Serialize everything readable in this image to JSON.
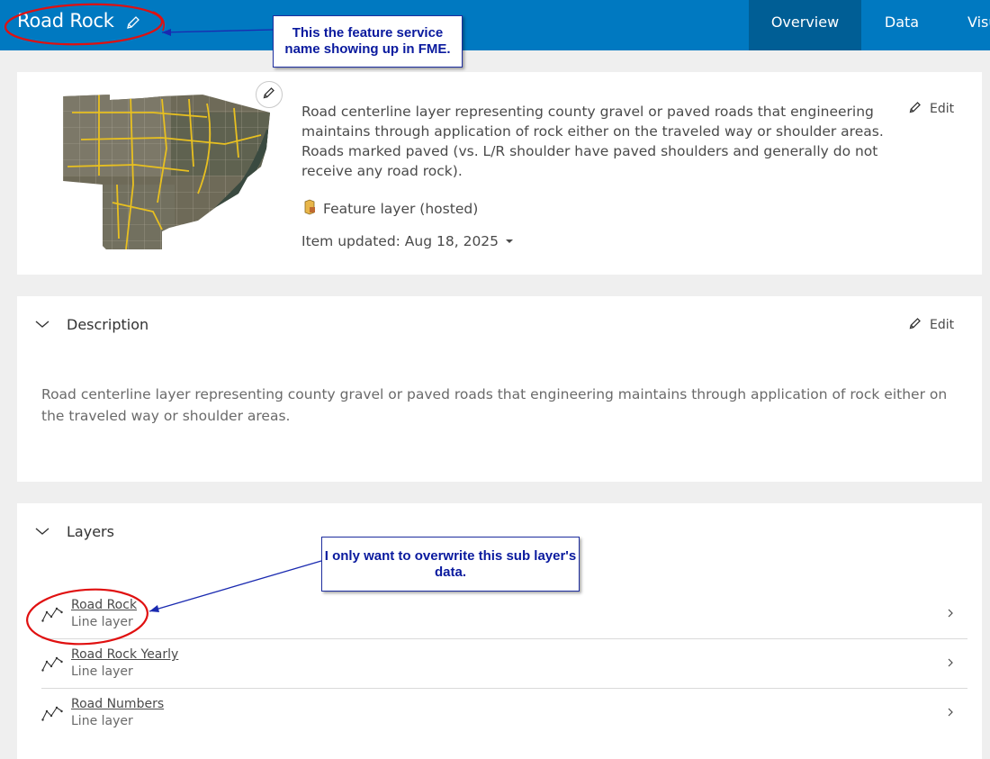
{
  "header": {
    "title": "Road Rock",
    "tabs": [
      {
        "label": "Overview",
        "active": true
      },
      {
        "label": "Data",
        "active": false
      },
      {
        "label": "Visu",
        "active": false
      }
    ],
    "bg_color": "#0079c1",
    "active_tab_color": "#005e95"
  },
  "overview": {
    "summary": "Road centerline layer representing county gravel or paved roads that engineering maintains through application of rock either on the traveled way or shoulder areas.  Roads marked paved (vs. L/R shoulder have paved shoulders and generally do not receive any road rock).",
    "edit_label": "Edit",
    "item_type": "Feature layer (hosted)",
    "item_updated": "Item updated: Aug 18, 2025"
  },
  "description": {
    "heading": "Description",
    "edit_label": "Edit",
    "text": "Road centerline layer representing county gravel or paved roads that engineering maintains through application of rock either on the traveled way or shoulder areas."
  },
  "layers": {
    "heading": "Layers",
    "items": [
      {
        "name": "Road Rock",
        "type": "Line layer"
      },
      {
        "name": "Road Rock Yearly",
        "type": "Line layer"
      },
      {
        "name": "Road Numbers",
        "type": "Line layer"
      }
    ]
  },
  "annotations": {
    "note1": "This the feature service name showing up in FME.",
    "note2": "I only want to overwrite this sub layer's data.",
    "note_color": "#0a1a9e",
    "circle_color": "#e01010"
  }
}
